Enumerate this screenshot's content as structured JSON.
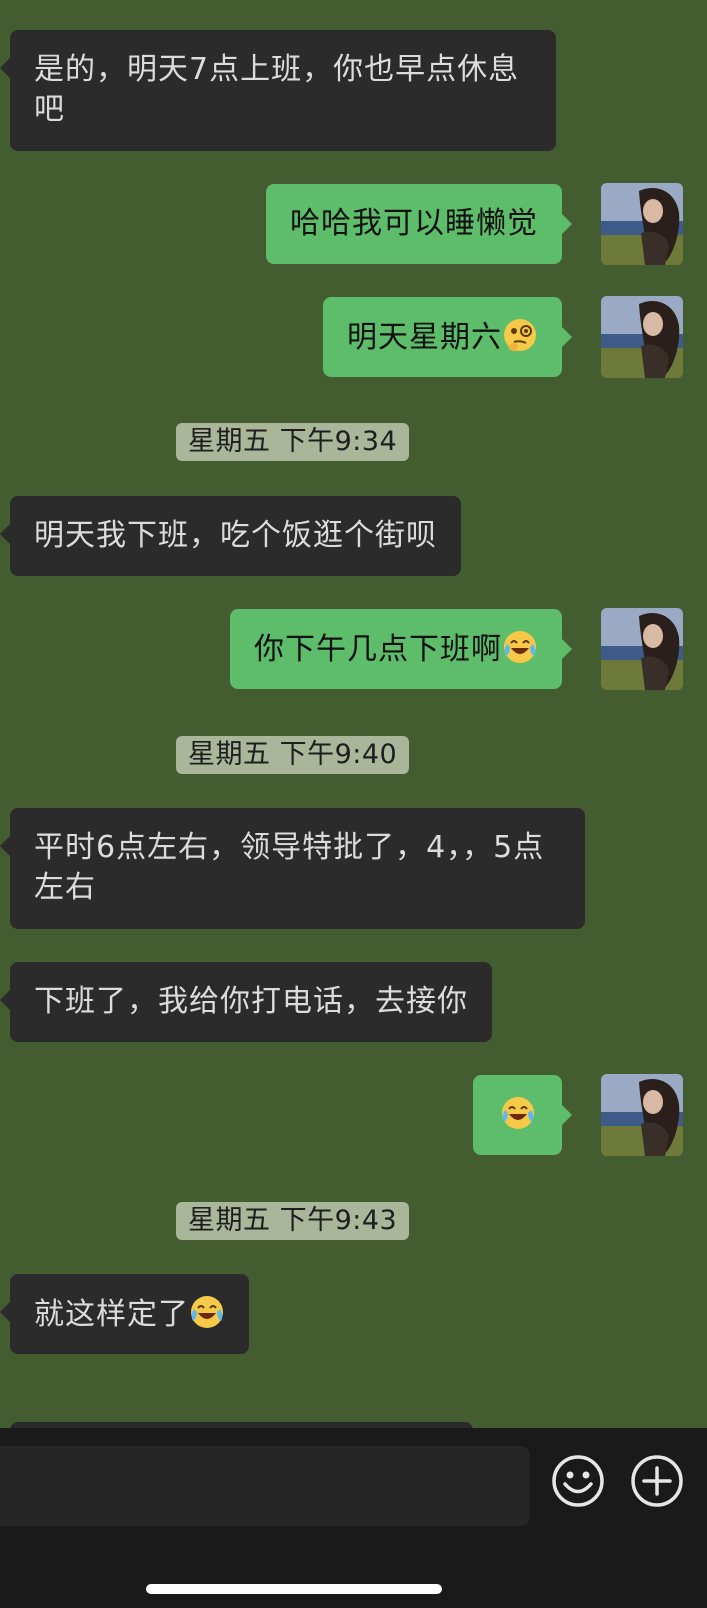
{
  "chat": {
    "m1": "是的，明天7点上班，你也早点休息吧",
    "m2": "哈哈我可以睡懒觉",
    "m3": "明天星期六",
    "t1": "星期五 下午9:34",
    "m4": "明天我下班，吃个饭逛个街呗",
    "m5": "你下午几点下班啊",
    "t2": "星期五 下午9:40",
    "m6": "平时6点左右，领导特批了，4，，5点左右",
    "m7": "下班了，我给你打电话，去接你",
    "t3": "星期五 下午9:43",
    "m9": "就这样定了"
  },
  "icons": {
    "emoji_thinking": "face-with-monocle",
    "emoji_laugh": "face-with-tears-of-joy",
    "voice_toggle": "smile-emoji-button",
    "more": "plus-button"
  },
  "colors": {
    "background": "#435d30",
    "incoming_bubble": "#2b2b2b",
    "outgoing_bubble": "#5ebd6b",
    "timestamp_bg": "#a9b69a"
  }
}
